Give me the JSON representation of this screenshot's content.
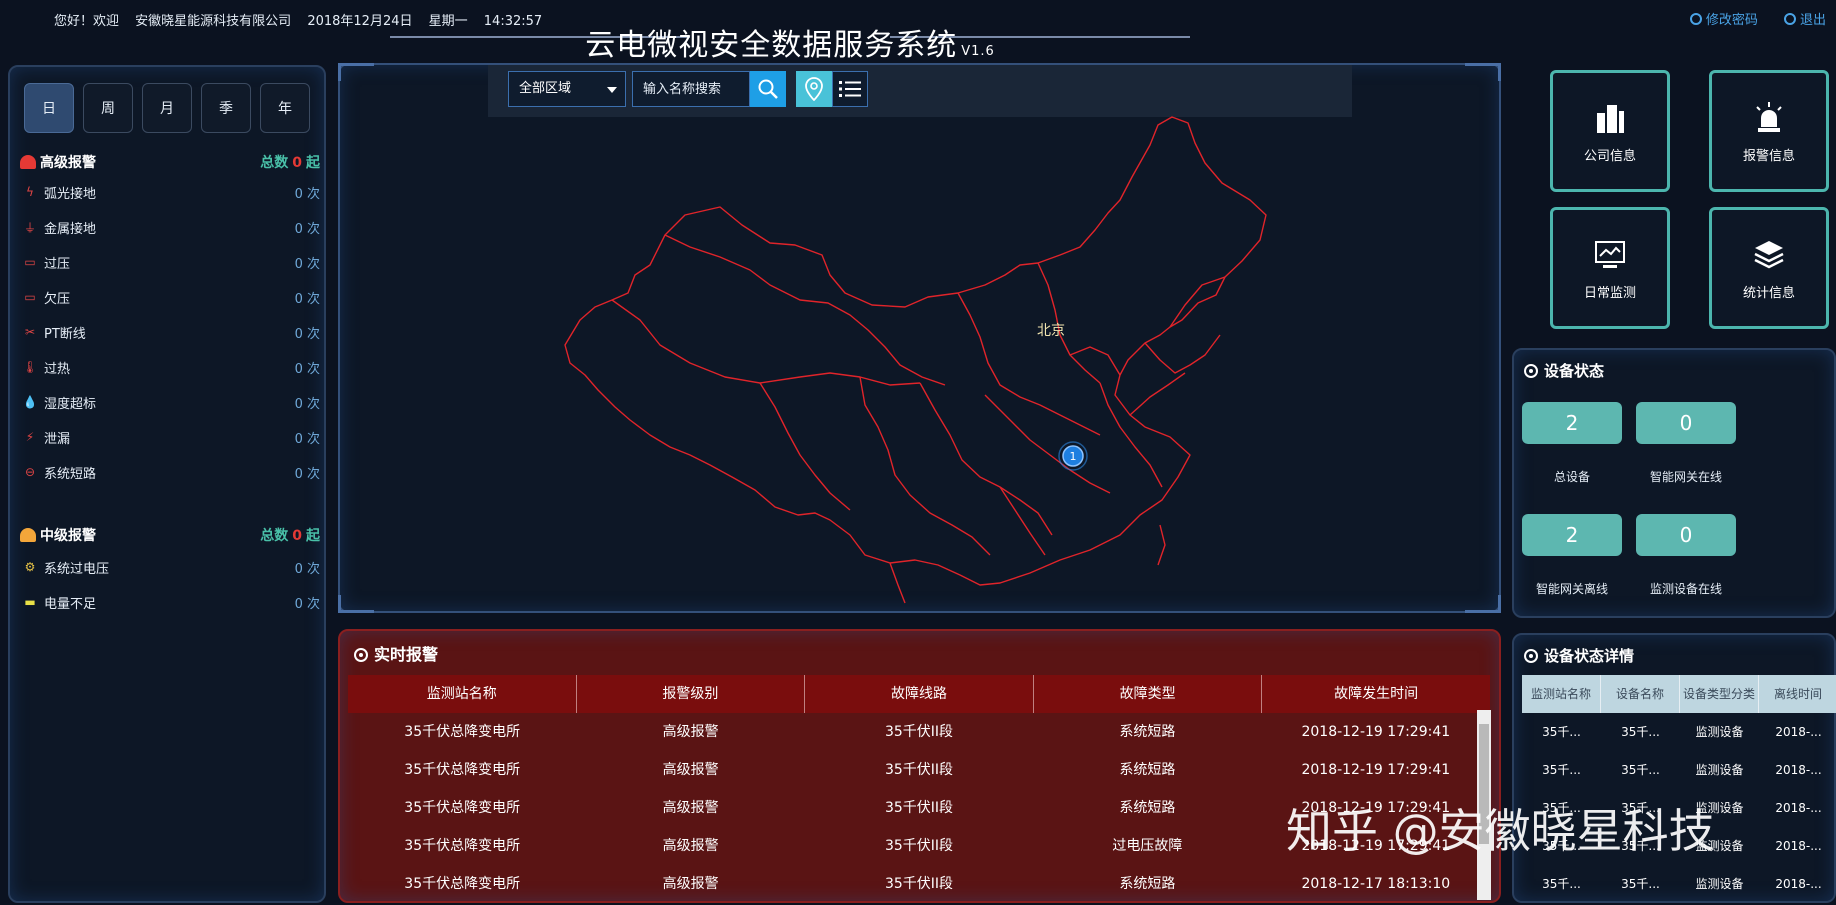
{
  "header": {
    "greeting": "您好！欢迎",
    "company": "安徽晓星能源科技有限公司",
    "date": "2018年12月24日",
    "weekday": "星期一",
    "time": "14:32:57",
    "title": "云电微视安全数据服务系统",
    "version": "V1.6",
    "change_password": "修改密码",
    "logout": "退出"
  },
  "period_tabs": [
    "日",
    "周",
    "月",
    "季",
    "年"
  ],
  "high_alarm": {
    "title": "高级报警",
    "total_prefix": "总数",
    "total": "0",
    "total_suffix": "起",
    "items": [
      {
        "label": "弧光接地",
        "count": "0 次",
        "icon": "arc-ground-icon"
      },
      {
        "label": "金属接地",
        "count": "0 次",
        "icon": "ground-icon"
      },
      {
        "label": "过压",
        "count": "0 次",
        "icon": "overvoltage-icon"
      },
      {
        "label": "欠压",
        "count": "0 次",
        "icon": "undervoltage-icon"
      },
      {
        "label": "PT断线",
        "count": "0 次",
        "icon": "pt-break-icon"
      },
      {
        "label": "过热",
        "count": "0 次",
        "icon": "thermometer-icon"
      },
      {
        "label": "湿度超标",
        "count": "0 次",
        "icon": "humidity-icon"
      },
      {
        "label": "泄漏",
        "count": "0 次",
        "icon": "leak-icon"
      },
      {
        "label": "系统短路",
        "count": "0 次",
        "icon": "short-circuit-icon"
      }
    ]
  },
  "mid_alarm": {
    "title": "中级报警",
    "total_prefix": "总数",
    "total": "0",
    "total_suffix": "起",
    "items": [
      {
        "label": "系统过电压",
        "count": "0 次",
        "icon": "gear-icon"
      },
      {
        "label": "电量不足",
        "count": "0 次",
        "icon": "battery-icon"
      }
    ]
  },
  "map": {
    "region_select": "全部区域",
    "search_placeholder": "输入名称搜索",
    "city_label": "北京",
    "marker_count": "1"
  },
  "quick_buttons": [
    {
      "label": "公司信息",
      "icon": "building-icon"
    },
    {
      "label": "报警信息",
      "icon": "alarm-light-icon"
    },
    {
      "label": "日常监测",
      "icon": "monitor-icon"
    },
    {
      "label": "统计信息",
      "icon": "layers-icon"
    }
  ],
  "realtime_alarm": {
    "title": "实时报警",
    "columns": [
      "监测站名称",
      "报警级别",
      "故障线路",
      "故障类型",
      "故障发生时间"
    ],
    "rows": [
      [
        "35千伏总降变电所",
        "高级报警",
        "35千伏II段",
        "系统短路",
        "2018-12-19 17:29:41"
      ],
      [
        "35千伏总降变电所",
        "高级报警",
        "35千伏II段",
        "系统短路",
        "2018-12-19 17:29:41"
      ],
      [
        "35千伏总降变电所",
        "高级报警",
        "35千伏II段",
        "系统短路",
        "2018-12-19 17:29:41"
      ],
      [
        "35千伏总降变电所",
        "高级报警",
        "35千伏II段",
        "过电压故障",
        "2018-12-19 17:29:41"
      ],
      [
        "35千伏总降变电所",
        "高级报警",
        "35千伏II段",
        "系统短路",
        "2018-12-17 18:13:10"
      ]
    ]
  },
  "device_status": {
    "title": "设备状态",
    "stats": [
      {
        "value": "2",
        "label": "总设备"
      },
      {
        "value": "0",
        "label": "智能网关在线"
      },
      {
        "value": "2",
        "label": "智能网关离线"
      },
      {
        "value": "0",
        "label": "监测设备在线"
      }
    ]
  },
  "device_detail": {
    "title": "设备状态详情",
    "columns": [
      "监测站名称",
      "设备名称",
      "设备类型分类",
      "离线时间"
    ],
    "rows": [
      [
        "35千...",
        "35千...",
        "监测设备",
        "2018-..."
      ],
      [
        "35千...",
        "35千...",
        "监测设备",
        "2018-..."
      ],
      [
        "35千...",
        "35千...",
        "监测设备",
        "2018-..."
      ],
      [
        "35千...",
        "35千...",
        "监测设备",
        "2018-..."
      ],
      [
        "35千...",
        "35千...",
        "监测设备",
        "2018-..."
      ]
    ]
  },
  "watermark": "知乎 @安徽晓星科技",
  "colors": {
    "background": "#0b1220",
    "accent_teal": "#4cb6ae",
    "alarm_red": "#7a0d0d",
    "map_border": "#e0242a",
    "link_blue": "#4aa3e6"
  }
}
